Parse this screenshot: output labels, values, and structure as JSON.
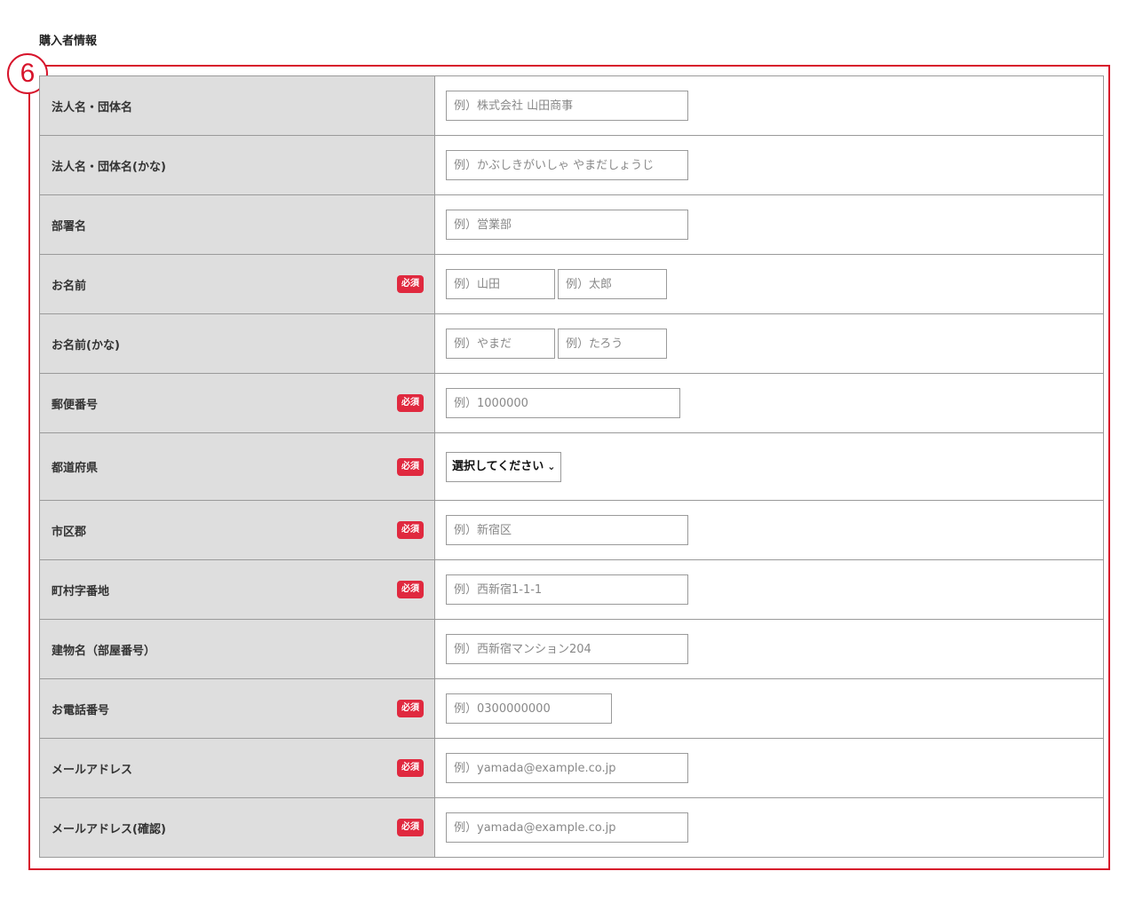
{
  "section": {
    "title": "購入者情報",
    "step": "6"
  },
  "required_label": "必須",
  "rows": [
    {
      "label": "法人名・団体名",
      "placeholder": "例）株式会社 山田商事"
    },
    {
      "label": "法人名・団体名(かな)",
      "placeholder": "例）かぶしきがいしゃ やまだしょうじ"
    },
    {
      "label": "部署名",
      "placeholder": "例）営業部"
    },
    {
      "label": "お名前",
      "placeholder_last": "例）山田",
      "placeholder_first": "例）太郎"
    },
    {
      "label": "お名前(かな)",
      "placeholder_last": "例）やまだ",
      "placeholder_first": "例）たろう"
    },
    {
      "label": "郵便番号",
      "placeholder": "例）1000000"
    },
    {
      "label": "都道府県",
      "select_value": "選択してください"
    },
    {
      "label": "市区郡",
      "placeholder": "例）新宿区"
    },
    {
      "label": "町村字番地",
      "placeholder": "例）西新宿1-1-1"
    },
    {
      "label": "建物名（部屋番号）",
      "placeholder": "例）西新宿マンション204"
    },
    {
      "label": "お電話番号",
      "placeholder": "例）0300000000"
    },
    {
      "label": "メールアドレス",
      "placeholder": "例）yamada@example.co.jp"
    },
    {
      "label": "メールアドレス(確認)",
      "placeholder": "例）yamada@example.co.jp"
    }
  ],
  "colors": {
    "accent": "#d7142b",
    "required_badge": "#e0293f",
    "label_bg": "#dedede"
  }
}
